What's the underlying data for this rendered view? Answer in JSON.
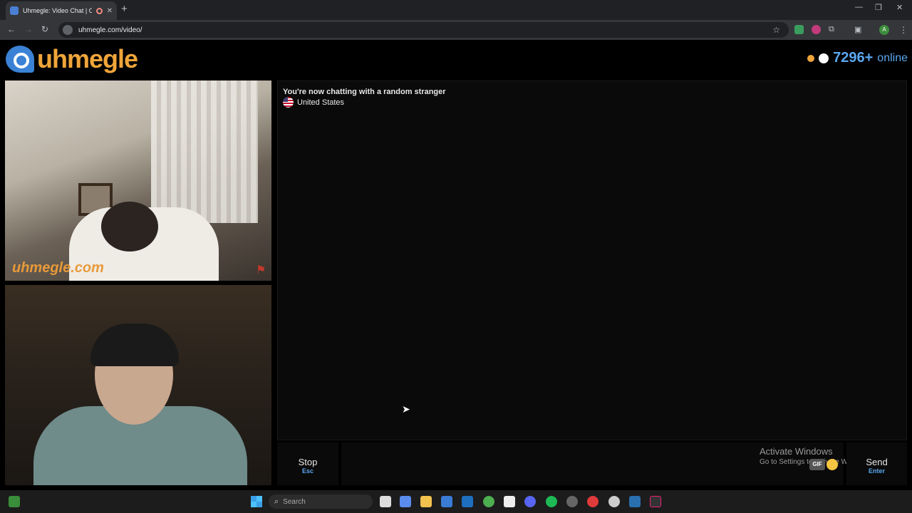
{
  "browser": {
    "tab_title": "Uhmegle: Video Chat | Ome",
    "new_tab": "+",
    "url": "uhmegle.com/video/",
    "window_controls": {
      "minimize": "—",
      "maximize": "❐",
      "close": "✕"
    },
    "profile_initial": "A"
  },
  "site": {
    "logo_text": "uhmegle",
    "online_count": "7296+",
    "online_label": "online"
  },
  "video": {
    "watermark": "uhmegle.com"
  },
  "chat": {
    "status": "You're now chatting with a random stranger",
    "country": "United States"
  },
  "controls": {
    "stop_label": "Stop",
    "stop_key": "Esc",
    "send_label": "Send",
    "send_key": "Enter",
    "gif_label": "GIF"
  },
  "windows_notice": {
    "line1": "Activate Windows",
    "line2": "Go to Settings to activate Windows."
  },
  "taskbar": {
    "search_placeholder": "Search",
    "apps": [
      "file-icon",
      "copilot-icon",
      "folder-icon",
      "store-icon",
      "outlook-icon",
      "chrome-icon",
      "tidal-icon",
      "discord-icon",
      "spotify-icon",
      "steam-icon",
      "opera-icon",
      "settings-icon",
      "steam2-icon",
      "epic-icon"
    ]
  },
  "colors": {
    "accent_blue": "#5aa7f0",
    "logo_orange": "#f0a53a"
  }
}
